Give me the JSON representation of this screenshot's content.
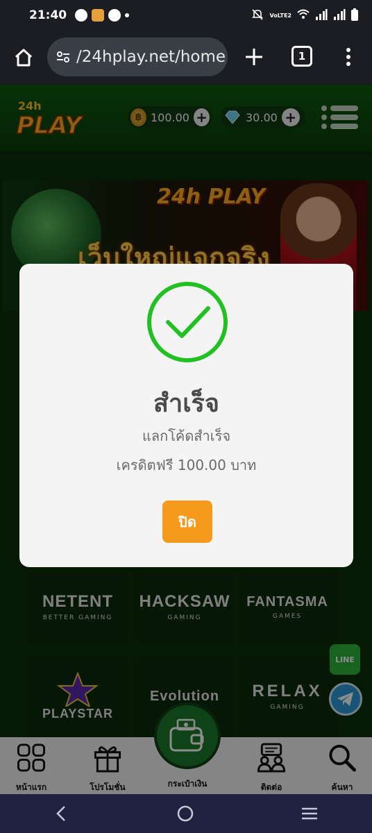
{
  "status_bar": {
    "time": "21:40",
    "network_label": "VoLTE2"
  },
  "browser": {
    "url": "/24hplay.net/home",
    "tab_count": "1"
  },
  "header": {
    "logo_text": "24h PLAY",
    "coin_balance": "100.00",
    "gem_balance": "30.00",
    "coin_symbol": "฿"
  },
  "banner": {
    "logo_text": "24h PLAY",
    "headline": "เว็บใหญ่แจกจริง"
  },
  "providers": [
    {
      "name": "NETENT",
      "sub": "BETTER GAMING"
    },
    {
      "name": "HACKSAW",
      "sub": "GAMING"
    },
    {
      "name": "FANTASMA",
      "sub": "GAMES"
    },
    {
      "name": "PLAYSTAR",
      "sub": ""
    },
    {
      "name": "Evolution",
      "sub": ""
    },
    {
      "name": "RELAX",
      "sub": "GAMING"
    }
  ],
  "floating": {
    "line_label": "LINE"
  },
  "bottom_nav": {
    "home": "หน้าแรก",
    "promotion": "โปรโมชั่น",
    "wallet": "กระเป๋าเงิน",
    "contact": "ติดต่อ",
    "search": "ค้นหา"
  },
  "modal": {
    "title": "สำเร็จ",
    "message": "แลกโค้ดสำเร็จ",
    "amount": "เครดิตฟรี 100.00 บาท",
    "close_label": "ปิด",
    "success_color": "#22c022",
    "button_color": "#f59a1d"
  }
}
